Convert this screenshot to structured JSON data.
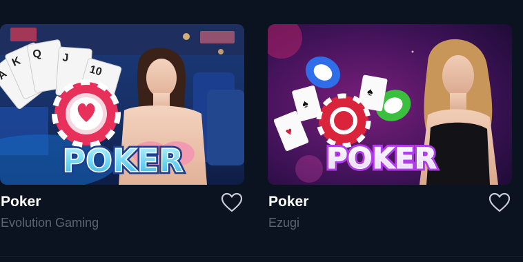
{
  "games": [
    {
      "title": "Poker",
      "provider": "Evolution Gaming",
      "logo_text": "POKER",
      "card_ranks": [
        "A",
        "K",
        "Q",
        "J",
        "10"
      ],
      "accent_color": "#e8315a"
    },
    {
      "title": "Poker",
      "provider": "Ezugi",
      "logo_text": "POKER",
      "accent_color": "#ff3fb0"
    }
  ],
  "icons": {
    "favorite": "heart-outline-icon"
  },
  "colors": {
    "background": "#0b1220",
    "title": "#ffffff",
    "provider": "#5b6473"
  }
}
